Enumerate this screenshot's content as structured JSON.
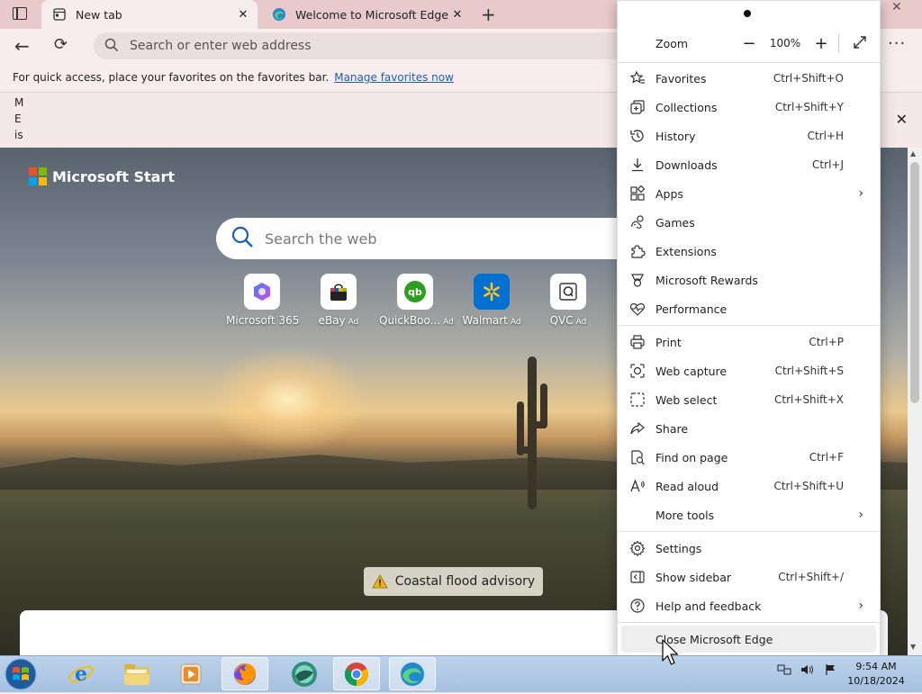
{
  "tabs": [
    {
      "label": "New tab",
      "icon": "newtab-icon",
      "active": true
    },
    {
      "label": "Welcome to Microsoft Edge",
      "icon": "edge-icon",
      "active": false
    }
  ],
  "toolbar": {
    "address_placeholder": "Search or enter web address"
  },
  "favorites_bar": {
    "text": "For quick access, place your favorites on the favorites bar.",
    "link": "Manage favorites now"
  },
  "infobar": {
    "text": "M E is"
  },
  "newtab": {
    "brand": "Microsoft Start",
    "search_placeholder": "Search the web",
    "tiles": [
      {
        "label": "Microsoft 365",
        "ad": ""
      },
      {
        "label": "eBay",
        "ad": "Ad"
      },
      {
        "label": "QuickBoo...",
        "ad": "Ad"
      },
      {
        "label": "Walmart",
        "ad": "Ad"
      },
      {
        "label": "QVC",
        "ad": "Ad"
      }
    ],
    "flood_alert": "Coastal flood advisory"
  },
  "menu": {
    "zoom_label": "Zoom",
    "zoom_value": "100%",
    "items": [
      {
        "label": "Favorites",
        "shortcut": "Ctrl+Shift+O",
        "icon": "favorites-icon"
      },
      {
        "label": "Collections",
        "shortcut": "Ctrl+Shift+Y",
        "icon": "collections-icon"
      },
      {
        "label": "History",
        "shortcut": "Ctrl+H",
        "icon": "history-icon"
      },
      {
        "label": "Downloads",
        "shortcut": "Ctrl+J",
        "icon": "downloads-icon"
      },
      {
        "label": "Apps",
        "shortcut": "",
        "icon": "apps-icon",
        "submenu": true
      },
      {
        "label": "Games",
        "shortcut": "",
        "icon": "games-icon"
      },
      {
        "label": "Extensions",
        "shortcut": "",
        "icon": "extensions-icon"
      },
      {
        "label": "Microsoft Rewards",
        "shortcut": "",
        "icon": "rewards-icon"
      },
      {
        "label": "Performance",
        "shortcut": "",
        "icon": "performance-icon"
      },
      {
        "label": "Print",
        "shortcut": "Ctrl+P",
        "icon": "print-icon"
      },
      {
        "label": "Web capture",
        "shortcut": "Ctrl+Shift+S",
        "icon": "web-capture-icon"
      },
      {
        "label": "Web select",
        "shortcut": "Ctrl+Shift+X",
        "icon": "web-select-icon"
      },
      {
        "label": "Share",
        "shortcut": "",
        "icon": "share-icon"
      },
      {
        "label": "Find on page",
        "shortcut": "Ctrl+F",
        "icon": "find-icon"
      },
      {
        "label": "Read aloud",
        "shortcut": "Ctrl+Shift+U",
        "icon": "read-aloud-icon"
      },
      {
        "label": "More tools",
        "shortcut": "",
        "icon": "",
        "submenu": true
      },
      {
        "label": "Settings",
        "shortcut": "",
        "icon": "settings-icon"
      },
      {
        "label": "Show sidebar",
        "shortcut": "Ctrl+Shift+/",
        "icon": "sidebar-icon"
      },
      {
        "label": "Help and feedback",
        "shortcut": "",
        "icon": "help-icon",
        "submenu": true
      }
    ],
    "close_label": "Close Microsoft Edge"
  },
  "taskbar": {
    "time": "9:54 AM",
    "date": "10/18/2024"
  }
}
